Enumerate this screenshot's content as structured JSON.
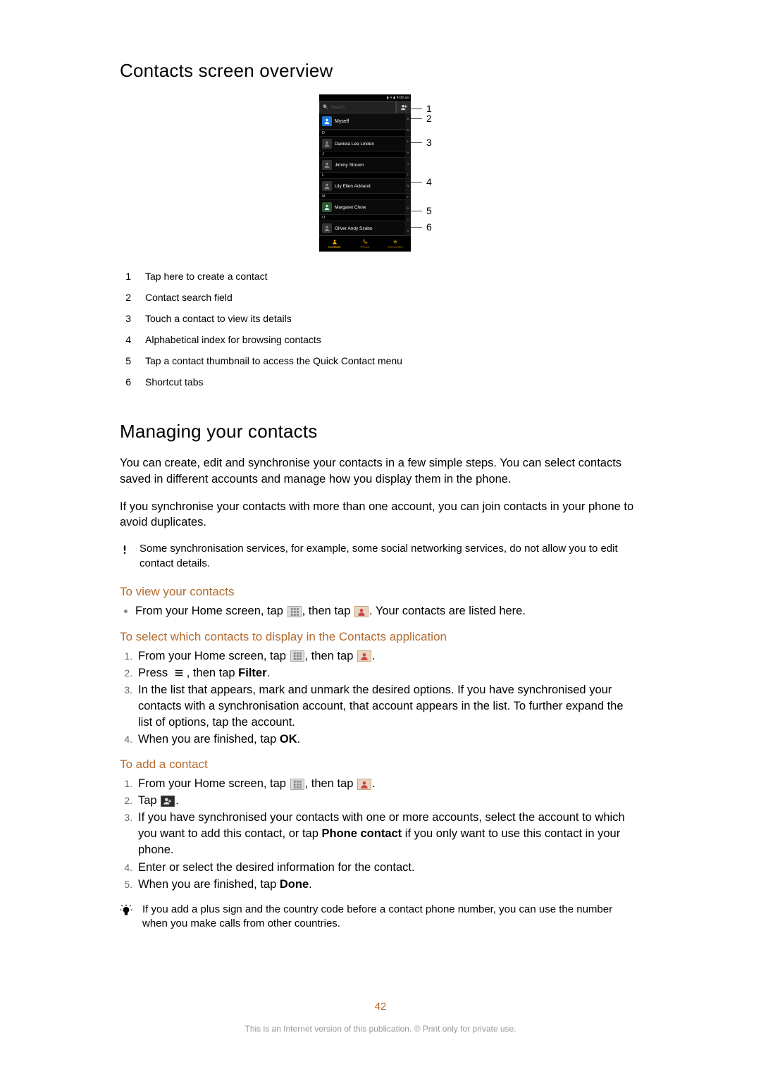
{
  "heading_overview": "Contacts screen overview",
  "phone": {
    "status_time": "4:00 am",
    "search_placeholder": "Search",
    "myself_label": "Myself",
    "sections": {
      "D": "D",
      "J": "J",
      "L": "L",
      "M": "M",
      "O": "O"
    },
    "contacts": {
      "c1": "Daniela Lee Linden",
      "c2": "Jimmy Stroom",
      "c3": "Lily Ellen Ackland",
      "c4": "Margaret Chow",
      "c5": "Oliver Andy Szabo"
    },
    "index_letters": [
      "B",
      "C",
      "D",
      "E",
      "F",
      "G",
      "H",
      "J",
      "K",
      "L",
      "M",
      "N",
      "O",
      "R",
      "S",
      "T",
      "U",
      "V",
      "W"
    ],
    "tabs": {
      "contacts": "Contacts",
      "phone": "Phone",
      "favourites": "Favourites"
    }
  },
  "callouts": {
    "c1": "1",
    "c2": "2",
    "c3": "3",
    "c4": "4",
    "c5": "5",
    "c6": "6"
  },
  "legend": {
    "r1n": "1",
    "r1t": "Tap here to create a contact",
    "r2n": "2",
    "r2t": "Contact search field",
    "r3n": "3",
    "r3t": "Touch a contact to view its details",
    "r4n": "4",
    "r4t": "Alphabetical index for browsing contacts",
    "r5n": "5",
    "r5t": "Tap a contact thumbnail to access the Quick Contact menu",
    "r6n": "6",
    "r6t": "Shortcut tabs"
  },
  "heading_managing": "Managing your contacts",
  "para1": "You can create, edit and synchronise your contacts in a few simple steps. You can select contacts saved in different accounts and manage how you display them in the phone.",
  "para2": "If you synchronise your contacts with more than one account, you can join contacts in your phone to avoid duplicates.",
  "alert_text": "Some synchronisation services, for example, some social networking services, do not allow you to edit contact details.",
  "sub_view": "To view your contacts",
  "view_pre": "From your Home screen, tap ",
  "view_mid": ", then tap ",
  "view_post": ". Your contacts are listed here.",
  "sub_select": "To select which contacts to display in the Contacts application",
  "sel_1_pre": "From your Home screen, tap ",
  "sel_1_mid": ", then tap ",
  "sel_1_post": ".",
  "sel_2_pre": "Press ",
  "sel_2_mid": ", then tap ",
  "sel_2_filter": "Filter",
  "sel_2_post": ".",
  "sel_3": "In the list that appears, mark and unmark the desired options. If you have synchronised your contacts with a synchronisation account, that account appears in the list. To further expand the list of options, tap the account.",
  "sel_4_pre": "When you are finished, tap ",
  "sel_4_ok": "OK",
  "sel_4_post": ".",
  "sub_add": "To add a contact",
  "add_1_pre": "From your Home screen, tap ",
  "add_1_mid": ", then tap ",
  "add_1_post": ".",
  "add_2_pre": "Tap ",
  "add_2_post": ".",
  "add_3_pre": "If you have synchronised your contacts with one or more accounts, select the account to which you want to add this contact, or tap ",
  "add_3_bold": "Phone contact",
  "add_3_post": " if you only want to use this contact in your phone.",
  "add_4": "Enter or select the desired information for the contact.",
  "add_5_pre": "When you are finished, tap ",
  "add_5_done": "Done",
  "add_5_post": ".",
  "tip_text": "If you add a plus sign and the country code before a contact phone number, you can use the number when you make calls from other countries.",
  "page_number": "42",
  "footer_text": "This is an Internet version of this publication. © Print only for private use."
}
